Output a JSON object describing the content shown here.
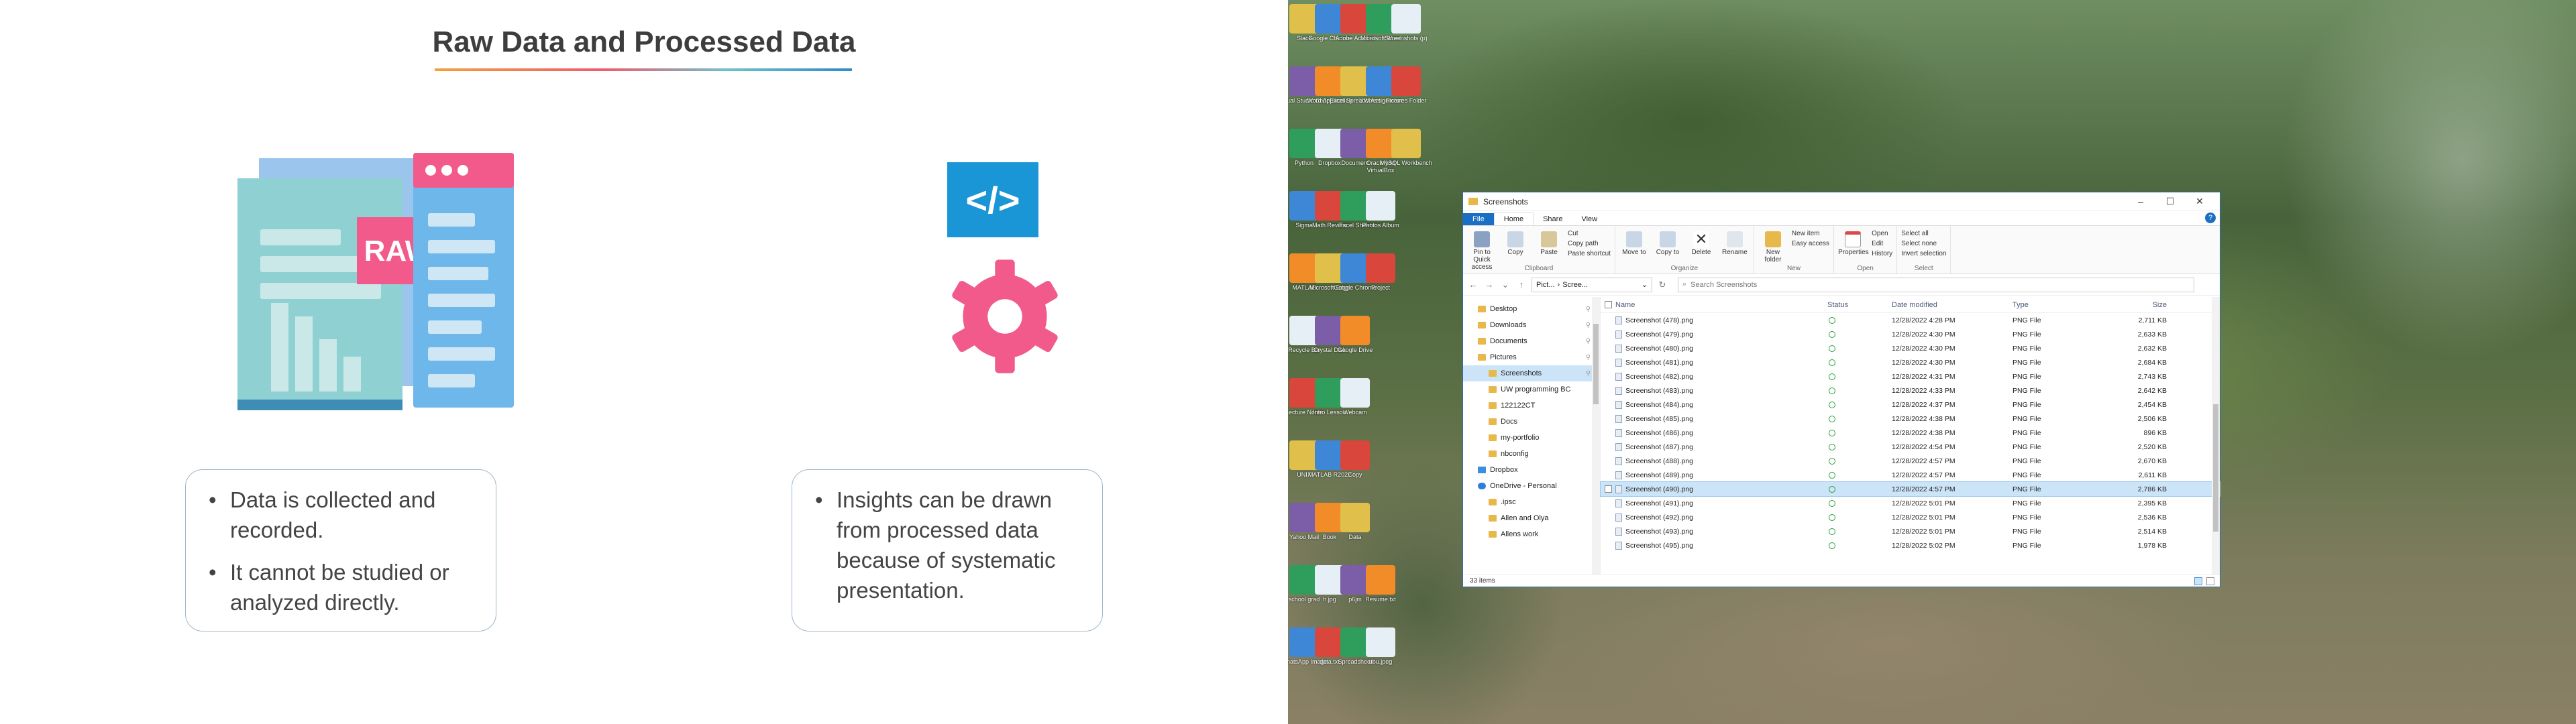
{
  "slide": {
    "title": "Raw Data and Processed Data",
    "raw_badge": "RAW",
    "left_points": [
      "Data is collected and recorded.",
      "It cannot be studied or analyzed directly."
    ],
    "right_points": [
      "Insights can be drawn from processed data because of systematic presentation."
    ],
    "code_glyph": "</>",
    "colors": {
      "accent_pink": "#f15a8a",
      "accent_blue": "#1a96d6",
      "doc_teal": "#8fd0d3"
    }
  },
  "desktop": {
    "icons": [
      [
        "Slack",
        "Google Chrome",
        "Adobe Acrobat",
        "Microsoft Word",
        "Screenshots (p)"
      ],
      [
        "Visual Studio Code",
        "Word Application",
        "Excel Spreadsheet",
        "UW Assignment",
        "Pictures Folder"
      ],
      [
        "Python",
        "Dropbox",
        "Document",
        "Oracle VM VirtualBox",
        "MySQL Workbench"
      ],
      [
        "Sigma",
        "Math Review",
        "Excel Sheet",
        "Photos Album",
        ""
      ],
      [
        "MATLAB",
        "Microsoft Edge",
        "Google Chrome",
        "Project",
        ""
      ],
      [
        "Recycle Bin",
        "Crystal Disk",
        "Google Drive",
        "",
        ""
      ],
      [
        "Lecture Notes",
        "Intro Lesson",
        "Webcam",
        "",
        ""
      ],
      [
        "UNIX",
        "MATLAB R2022",
        "Copy",
        "",
        ""
      ],
      [
        "Yahoo Mail",
        "Book",
        "Data",
        "",
        ""
      ],
      [
        "school grad",
        "h.jpg",
        "p6jm",
        "Resume.txt",
        ""
      ],
      [
        "WhatsApp Image",
        "data.txt",
        "Spreadsheet",
        "ubu.jpeg",
        ""
      ]
    ]
  },
  "explorer": {
    "window_title": "Screenshots",
    "tabs": [
      "File",
      "Home",
      "Share",
      "View"
    ],
    "ribbon": {
      "clipboard": {
        "label": "Clipboard",
        "pin": "Pin to Quick access",
        "copy": "Copy",
        "paste": "Paste",
        "cut": "Cut",
        "copy_path": "Copy path",
        "paste_shortcut": "Paste shortcut"
      },
      "organize": {
        "label": "Organize",
        "move": "Move to",
        "copy_to": "Copy to",
        "delete": "Delete",
        "rename": "Rename"
      },
      "new": {
        "label": "New",
        "folder": "New folder",
        "item": "New item",
        "easy": "Easy access"
      },
      "open": {
        "label": "Open",
        "properties": "Properties",
        "open": "Open",
        "edit": "Edit",
        "history": "History"
      },
      "select": {
        "label": "Select",
        "all": "Select all",
        "none": "Select none",
        "invert": "Invert selection"
      }
    },
    "address": [
      "Pict...",
      "Scree..."
    ],
    "search_placeholder": "Search Screenshots",
    "nav": [
      {
        "label": "Desktop",
        "sub": false,
        "pin": true
      },
      {
        "label": "Downloads",
        "sub": false,
        "pin": true
      },
      {
        "label": "Documents",
        "sub": false,
        "pin": true
      },
      {
        "label": "Pictures",
        "sub": false,
        "pin": true
      },
      {
        "label": "Screenshots",
        "sub": true,
        "pin": true,
        "sel": true
      },
      {
        "label": "UW programming BC",
        "sub": true,
        "pin": false
      },
      {
        "label": "122122CT",
        "sub": true,
        "pin": false
      },
      {
        "label": "Docs",
        "sub": true,
        "pin": false
      },
      {
        "label": "my-portfolio",
        "sub": true,
        "pin": false
      },
      {
        "label": "nbconfig",
        "sub": true,
        "pin": false
      },
      {
        "label": "Dropbox",
        "sub": false,
        "pin": false
      },
      {
        "label": "OneDrive - Personal",
        "sub": false,
        "pin": false
      },
      {
        "label": ".ipsc",
        "sub": true,
        "pin": false
      },
      {
        "label": "Allen and Olya",
        "sub": true,
        "pin": false
      },
      {
        "label": "Allens work",
        "sub": true,
        "pin": false
      }
    ],
    "columns": {
      "name": "Name",
      "status": "Status",
      "date": "Date modified",
      "type": "Type",
      "size": "Size"
    },
    "rows": [
      {
        "name": "Screenshot (478).png",
        "date": "12/28/2022 4:28 PM",
        "type": "PNG File",
        "size": "2,711 KB"
      },
      {
        "name": "Screenshot (479).png",
        "date": "12/28/2022 4:30 PM",
        "type": "PNG File",
        "size": "2,633 KB"
      },
      {
        "name": "Screenshot (480).png",
        "date": "12/28/2022 4:30 PM",
        "type": "PNG File",
        "size": "2,632 KB"
      },
      {
        "name": "Screenshot (481).png",
        "date": "12/28/2022 4:30 PM",
        "type": "PNG File",
        "size": "2,684 KB"
      },
      {
        "name": "Screenshot (482).png",
        "date": "12/28/2022 4:31 PM",
        "type": "PNG File",
        "size": "2,743 KB"
      },
      {
        "name": "Screenshot (483).png",
        "date": "12/28/2022 4:33 PM",
        "type": "PNG File",
        "size": "2,642 KB"
      },
      {
        "name": "Screenshot (484).png",
        "date": "12/28/2022 4:37 PM",
        "type": "PNG File",
        "size": "2,454 KB"
      },
      {
        "name": "Screenshot (485).png",
        "date": "12/28/2022 4:38 PM",
        "type": "PNG File",
        "size": "2,506 KB"
      },
      {
        "name": "Screenshot (486).png",
        "date": "12/28/2022 4:38 PM",
        "type": "PNG File",
        "size": "896 KB"
      },
      {
        "name": "Screenshot (487).png",
        "date": "12/28/2022 4:54 PM",
        "type": "PNG File",
        "size": "2,520 KB"
      },
      {
        "name": "Screenshot (488).png",
        "date": "12/28/2022 4:57 PM",
        "type": "PNG File",
        "size": "2,670 KB"
      },
      {
        "name": "Screenshot (489).png",
        "date": "12/28/2022 4:57 PM",
        "type": "PNG File",
        "size": "2,611 KB"
      },
      {
        "name": "Screenshot (490).png",
        "date": "12/28/2022 4:57 PM",
        "type": "PNG File",
        "size": "2,786 KB",
        "sel": true
      },
      {
        "name": "Screenshot (491).png",
        "date": "12/28/2022 5:01 PM",
        "type": "PNG File",
        "size": "2,395 KB"
      },
      {
        "name": "Screenshot (492).png",
        "date": "12/28/2022 5:01 PM",
        "type": "PNG File",
        "size": "2,536 KB"
      },
      {
        "name": "Screenshot (493).png",
        "date": "12/28/2022 5:01 PM",
        "type": "PNG File",
        "size": "2,514 KB"
      },
      {
        "name": "Screenshot (495).png",
        "date": "12/28/2022 5:02 PM",
        "type": "PNG File",
        "size": "1,978 KB"
      }
    ],
    "status_text": "33 items"
  }
}
